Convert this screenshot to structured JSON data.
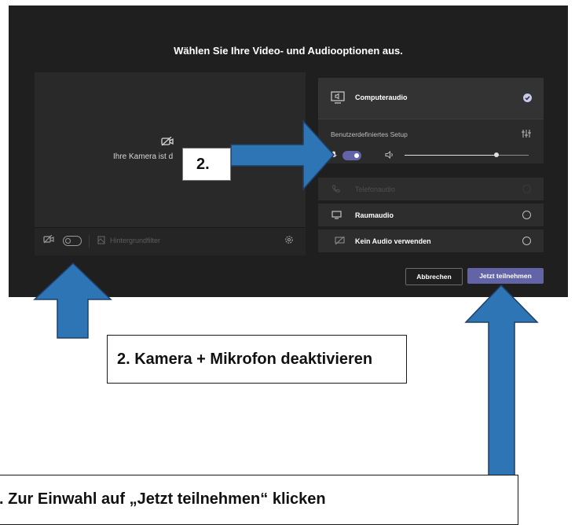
{
  "dialog": {
    "title": "Wählen Sie Ihre Video- und Audiooptionen aus."
  },
  "video": {
    "camera_off_text": "Ihre Kamera ist d",
    "background_filter_label": "Hintergrundfilter",
    "camera_toggle_state": "off"
  },
  "audio_options": {
    "computer_audio_label": "Computeraudio",
    "computer_audio_selected": true,
    "custom_setup_label": "Benutzerdefiniertes Setup",
    "mic_toggle_state": "on",
    "speaker_volume_level": 0.74,
    "phone_audio_label": "Telefonaudio",
    "room_audio_label": "Raumaudio",
    "no_audio_label": "Kein Audio verwenden"
  },
  "buttons": {
    "cancel_label": "Abbrechen",
    "join_label": "Jetzt teilnehmen"
  },
  "annotations": {
    "step_marker": "2.",
    "step2_text": "2. Kamera + Mikrofon deaktivieren",
    "step3_text": ". Zur Einwahl auf „Jetzt teilnehmen“ klicken"
  },
  "colors": {
    "screen_bg": "#1f1f1f",
    "panel_bg": "#2d2d2d",
    "accent": "#6264a7",
    "arrow_fill": "#2e75b6",
    "arrow_stroke": "#1f3f66"
  },
  "icons": {
    "computer_audio": "monitor-speaker-icon",
    "selected": "check-circle-icon",
    "settings": "sliders-icon",
    "mic": "mic-icon",
    "speaker": "speaker-icon",
    "phone": "phone-icon",
    "room": "monitor-icon",
    "no_audio": "no-audio-icon",
    "camera_off": "camera-off-icon",
    "background": "background-filter-icon",
    "gear": "gear-icon"
  }
}
